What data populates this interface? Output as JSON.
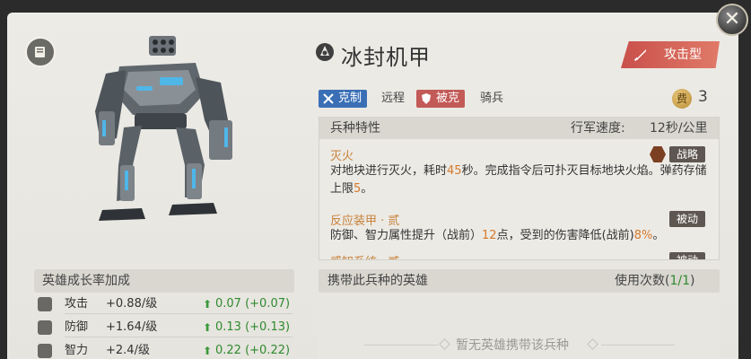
{
  "unit": {
    "name": "冰封机甲",
    "type_label": "攻击型",
    "counter_label": "克制",
    "counter_target": "远程",
    "countered_label": "被克",
    "countered_by": "骑兵",
    "cost_icon": "费",
    "cost": "3"
  },
  "traits": {
    "header_label": "兵种特性",
    "speed_label": "行军速度:",
    "speed_value": "12秒/公里",
    "items": [
      {
        "name": "灭火",
        "badge": "战略",
        "desc_parts": [
          "对地块进行灭火，耗时",
          "45",
          "秒。完成指令后可扑灭目标地块火焰。弹药存储上限",
          "5",
          "。"
        ]
      },
      {
        "name": "反应装甲 · 贰",
        "badge": "被动",
        "desc_parts": [
          "防御、智力属性提升（战前）",
          "12",
          "点，受到的伤害降低(战前)",
          "8%",
          "。"
        ]
      },
      {
        "name": "感知系统 · 贰",
        "badge": "被动"
      }
    ]
  },
  "growth": {
    "header": "英雄成长率加成",
    "rows": [
      {
        "name": "攻击",
        "value": "+0.88/级",
        "increase": "0.07 (+0.07)",
        "icon": "sword-icon"
      },
      {
        "name": "防御",
        "value": "+1.64/级",
        "increase": "0.13 (+0.13)",
        "icon": "shield-icon"
      },
      {
        "name": "智力",
        "value": "+2.4/级",
        "increase": "0.22 (+0.22)",
        "icon": "book-icon"
      }
    ]
  },
  "heroes": {
    "header": "携带此兵种的英雄",
    "uses_label": "使用次数(",
    "uses_value": "1/1",
    "uses_close": ")",
    "empty_text": "暂无英雄携带该兵种"
  },
  "colors": {
    "accent_red": "#c9504b",
    "counter_blue": "#3a6fb6",
    "highlight_orange": "#d5792a",
    "growth_green": "#2f8a2f"
  }
}
